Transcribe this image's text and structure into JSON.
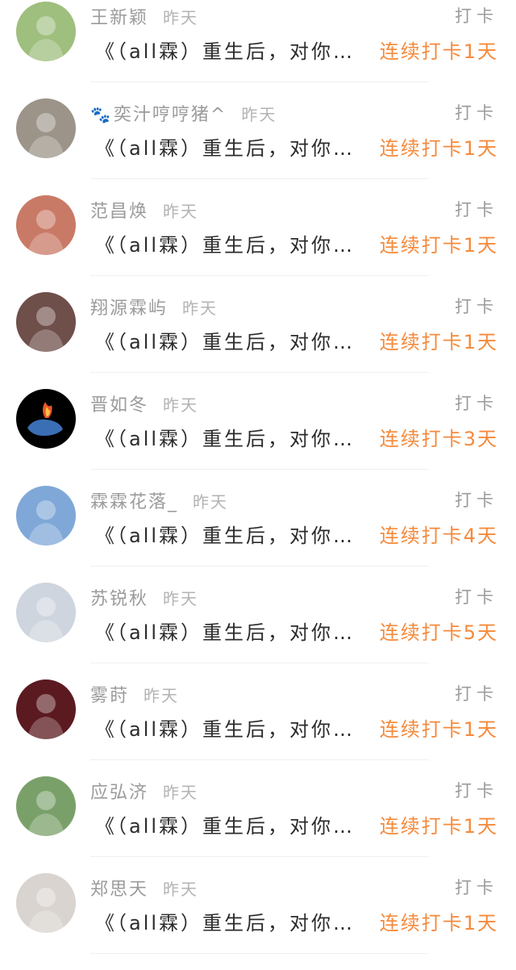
{
  "feed": {
    "items": [
      {
        "username": "王新颖",
        "time": "昨天",
        "action": "打卡",
        "title": "《（all霖）重生后，对你…",
        "streak": "连续打卡1天",
        "avatar_icon": "avatar-photo-icon",
        "bg": "#9fbf7e"
      },
      {
        "username": "奕汁哼哼猪^",
        "time": "昨天",
        "action": "打卡",
        "title": "《（all霖）重生后，对你…",
        "streak": "连续打卡1天",
        "avatar_icon": "avatar-photo-icon",
        "bg": "#9c9489"
      },
      {
        "username": "范昌焕",
        "time": "昨天",
        "action": "打卡",
        "title": "《（all霖）重生后，对你…",
        "streak": "连续打卡1天",
        "avatar_icon": "avatar-photo-icon",
        "bg": "#c97a66"
      },
      {
        "username": "翔源霖屿",
        "time": "昨天",
        "action": "打卡",
        "title": "《（all霖）重生后，对你…",
        "streak": "连续打卡1天",
        "avatar_icon": "avatar-photo-icon",
        "bg": "#6f4f4a"
      },
      {
        "username": "晋如冬",
        "time": "昨天",
        "action": "打卡",
        "title": "《（all霖）重生后，对你…",
        "streak": "连续打卡3天",
        "avatar_icon": "whale-logo-icon",
        "bg": "#000000"
      },
      {
        "username": "霖霖花落_",
        "time": "昨天",
        "action": "打卡",
        "title": "《（all霖）重生后，对你…",
        "streak": "连续打卡4天",
        "avatar_icon": "avatar-photo-icon",
        "bg": "#7fa8d8"
      },
      {
        "username": "苏锐秋",
        "time": "昨天",
        "action": "打卡",
        "title": "《（all霖）重生后，对你…",
        "streak": "连续打卡5天",
        "avatar_icon": "avatar-photo-icon",
        "bg": "#cfd5de"
      },
      {
        "username": "雾莳",
        "time": "昨天",
        "action": "打卡",
        "title": "《（all霖）重生后，对你…",
        "streak": "连续打卡1天",
        "avatar_icon": "avatar-photo-icon",
        "bg": "#5b1a20"
      },
      {
        "username": "应弘济",
        "time": "昨天",
        "action": "打卡",
        "title": "《（all霖）重生后，对你…",
        "streak": "连续打卡1天",
        "avatar_icon": "avatar-photo-icon",
        "bg": "#7aa06a"
      },
      {
        "username": "郑思天",
        "time": "昨天",
        "action": "打卡",
        "title": "《（all霖）重生后，对你…",
        "streak": "连续打卡1天",
        "avatar_icon": "avatar-photo-icon",
        "bg": "#d9d4cf"
      }
    ]
  }
}
